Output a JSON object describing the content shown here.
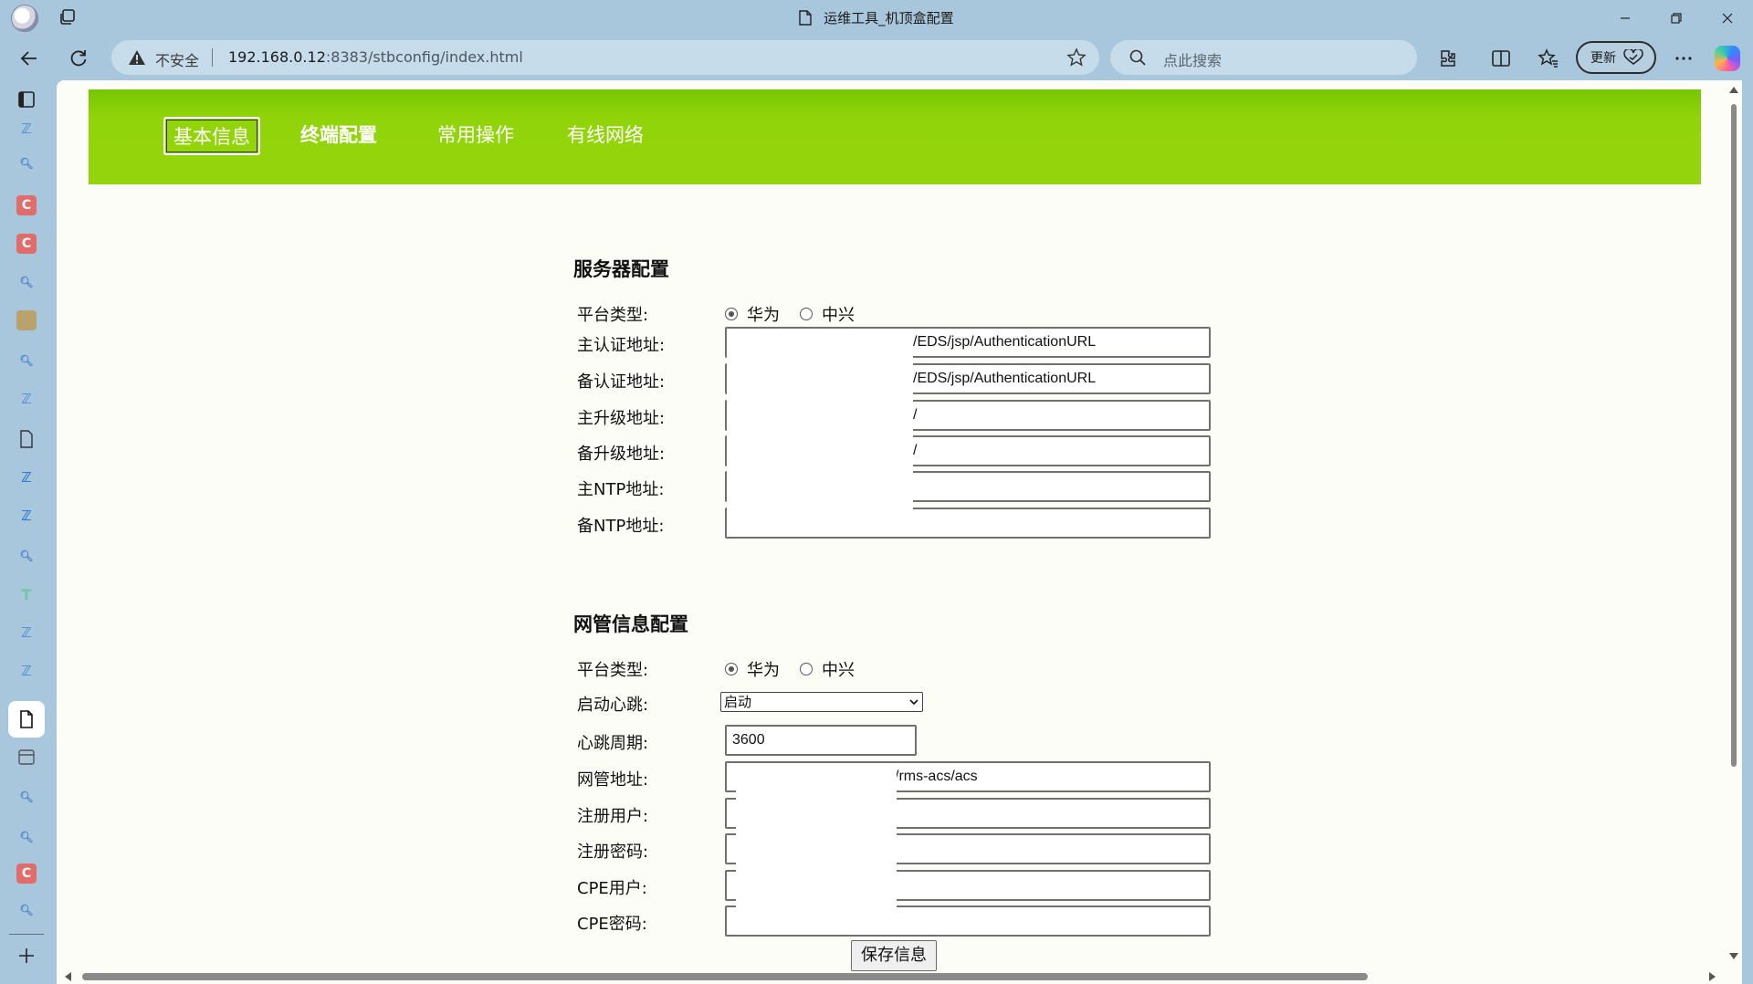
{
  "window": {
    "title": "运维工具_机顶盒配置"
  },
  "toolbar": {
    "security_label": "不安全",
    "url_host": "192.168.0.12",
    "url_rest": ":8383/stbconfig/index.html",
    "search_placeholder": "点此搜索",
    "update_label": "更新"
  },
  "nav_tabs": [
    {
      "label": "基本信息",
      "active": true
    },
    {
      "label": "终端配置",
      "active": false
    },
    {
      "label": "常用操作",
      "active": false
    },
    {
      "label": "有线网络",
      "active": false
    }
  ],
  "server_config": {
    "title": "服务器配置",
    "platform_label": "平台类型:",
    "platform_options": [
      "华为",
      "中兴"
    ],
    "platform_selected": "华为",
    "fields": [
      {
        "label": "主认证地址:",
        "value": "/EDS/jsp/AuthenticationURL"
      },
      {
        "label": "备认证地址:",
        "value": "/EDS/jsp/AuthenticationURL"
      },
      {
        "label": "主升级地址:",
        "value": "/"
      },
      {
        "label": "备升级地址:",
        "value": "/"
      },
      {
        "label": "主NTP地址:",
        "value": ""
      },
      {
        "label": "备NTP地址:",
        "value": ""
      }
    ]
  },
  "nms_config": {
    "title": "网管信息配置",
    "platform_label": "平台类型:",
    "platform_options": [
      "华为",
      "中兴"
    ],
    "platform_selected": "华为",
    "heartbeat_label": "启动心跳:",
    "heartbeat_value": "启动",
    "period_label": "心跳周期:",
    "period_value": "3600",
    "fields": [
      {
        "label": "网管地址:",
        "value": "/rms-acs/acs"
      },
      {
        "label": "注册用户:",
        "value": ""
      },
      {
        "label": "注册密码:",
        "value": ""
      },
      {
        "label": "CPE用户:",
        "value": ""
      },
      {
        "label": "CPE密码:",
        "value": ""
      }
    ]
  },
  "save_button": "保存信息",
  "colors": {
    "nav_green": "#94d40c",
    "chrome_blue": "#a9c7dc",
    "page_bg": "#fdfdf8"
  }
}
